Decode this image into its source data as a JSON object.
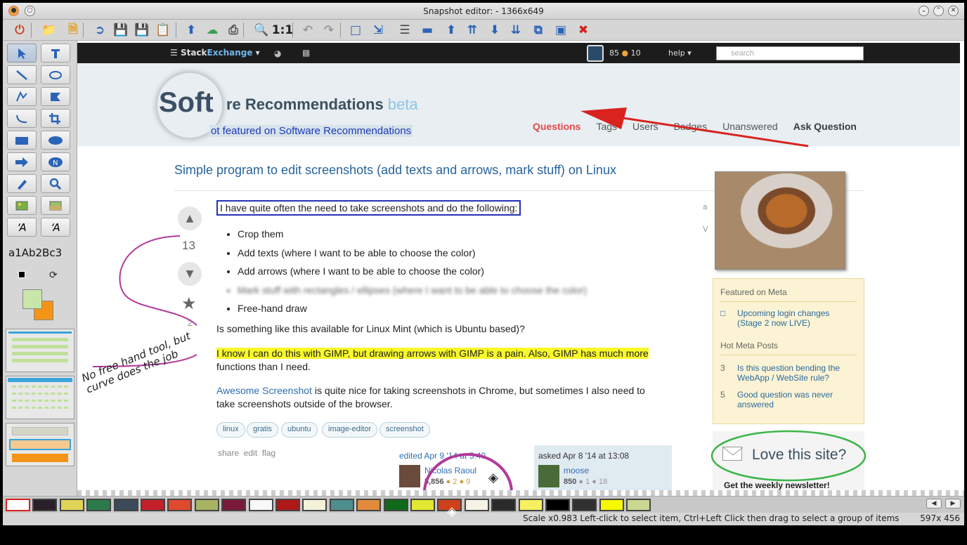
{
  "window": {
    "title": "Snapshot editor:  - 1366x649"
  },
  "toolbar": {
    "items": [
      "power-icon",
      "open-folder-icon",
      "new-image-icon",
      "export-icon",
      "save-icon",
      "save-as-icon",
      "clipboard-icon",
      "upload-icon",
      "cloud-upload-icon",
      "print-icon",
      "zoom-icon",
      "zoom-actual-icon",
      "undo-icon",
      "redo-icon",
      "crop-canvas-icon",
      "resize-icon",
      "align-icon",
      "rectangle-shape-icon",
      "arrow-up-icon",
      "arrow-up-double-icon",
      "arrow-down-icon",
      "arrow-down-double-icon",
      "copy-icon",
      "cube-icon",
      "delete-icon"
    ]
  },
  "tools": {
    "sample_text": "a1Ab2Bc3"
  },
  "page": {
    "se_logo_a": "Stack",
    "se_logo_b": "Exchange",
    "rep": "85",
    "badges": "10",
    "help": "help",
    "search_placeholder": "search",
    "site_title_main": "re Recommendations",
    "site_title_beta": "beta",
    "magnifier_text": "Soft",
    "featured": "ot featured on Software Recommendations",
    "nav": {
      "questions": "Questions",
      "tags": "Tags",
      "users": "Users",
      "badges": "Badges",
      "unanswered": "Unanswered",
      "ask": "Ask Question"
    },
    "question_title": "Simple program to edit screenshots (add texts and arrows, mark stuff) on Linux",
    "vote_count": "13",
    "fav_count": "2",
    "intro": "I have quite often the need to take screenshots and do the following:",
    "bullets": [
      "Crop them",
      "Add texts (where I want to be able to choose the color)",
      "Add arrows (where I want to be able to choose the color)",
      "Mark stuff with rectangles / ellipses (where I want to be able to choose the color)",
      "Free-hand draw"
    ],
    "p1": "Is something like this available for Linux Mint (which is Ubuntu based)?",
    "p2_highlight": "I know I can do this with GIMP, but drawing arrows with GIMP is a pain. Also, GIMP has much more",
    "p2_rest": "functions than I need.",
    "p3_link": "Awesome Screenshot",
    "p3_rest": " is quite nice for taking screenshots in Chrome, but sometimes I also need to",
    "p3_line2": "take screenshots outside of the browser.",
    "tags": [
      "linux",
      "gratis",
      "ubuntu",
      "image-editor",
      "screenshot"
    ],
    "actions": "share  edit  flag",
    "edited": "edited Apr 9 '14 at 5:40",
    "editor_name": "Nicolas Raoul",
    "editor_rep": "5,856",
    "editor_badges": "● 2  ● 9",
    "asked": "asked Apr 8 '14 at 13:08",
    "asker_name": "moose",
    "asker_rep": "850",
    "asker_badges": "● 1  ● 18",
    "featured_meta": "Featured on Meta",
    "meta_item": "Upcoming login changes (Stage 2 now LIVE)",
    "hot_meta": "Hot Meta Posts",
    "hot_items": [
      {
        "n": "3",
        "t": "Is this question bending the WebApp / WebSite rule?"
      },
      {
        "n": "5",
        "t": "Good question was never answered"
      }
    ],
    "love": "Love this site?",
    "newsletter": "Get the weekly newsletter!"
  },
  "annotations": {
    "handwriting": "No free hand tool, but curve does the job"
  },
  "palette": [
    "#ffffff",
    "#2b1f2a",
    "#e0d35a",
    "#2c7a4b",
    "#3d4a5a",
    "#c3202a",
    "#e04a2c",
    "#a8b464",
    "#7a1a3a",
    "#f8f8f8",
    "#b01818",
    "#f4f2d8",
    "#4e8e8e",
    "#e08a3a",
    "#0f6a1a",
    "#e2e832",
    "#d0401a",
    "#f6f2e6",
    "#2a2a2a",
    "#f6f060",
    "#000000",
    "#303030",
    "#f8f800",
    "#c8d890"
  ],
  "status": {
    "message": "Scale x0.983  Left-click to select item, Ctrl+Left Click then drag to select a group of items",
    "dimensions": "597x 456"
  }
}
